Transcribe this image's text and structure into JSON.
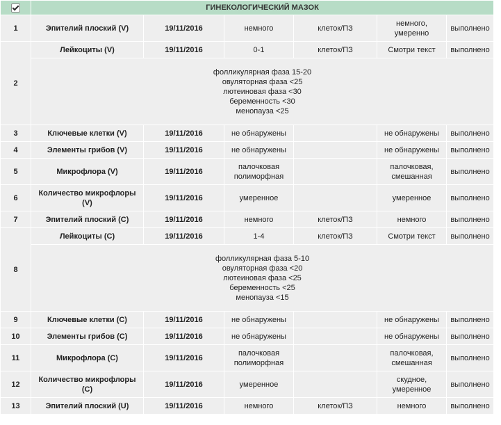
{
  "header": {
    "title": "ГИНЕКОЛОГИЧЕСКИЙ МАЗОК",
    "select_all_checked": true
  },
  "rows": [
    {
      "num": "1",
      "name": "Эпителий плоский (V)",
      "date": "19/11/2016",
      "result": "немного",
      "unit": "клеток/ПЗ",
      "ref": "немного, умеренно",
      "status": "выполнено"
    },
    {
      "num": "2",
      "name": "Лейкоциты (V)",
      "date": "19/11/2016",
      "result": "0-1",
      "unit": "клеток/ПЗ",
      "ref": "Смотри текст",
      "status": "выполнено",
      "note": [
        "фолликулярная фаза 15-20",
        "овуляторная фаза <25",
        "лютеиновая фаза <30",
        "беременность <30",
        "менопауза <25"
      ]
    },
    {
      "num": "3",
      "name": "Ключевые клетки (V)",
      "date": "19/11/2016",
      "result": "не обнаружены",
      "unit": "",
      "ref": "не обнаружены",
      "status": "выполнено"
    },
    {
      "num": "4",
      "name": "Элементы грибов (V)",
      "date": "19/11/2016",
      "result": "не обнаружены",
      "unit": "",
      "ref": "не обнаружены",
      "status": "выполнено"
    },
    {
      "num": "5",
      "name": "Микрофлора (V)",
      "date": "19/11/2016",
      "result": "палочковая полиморфная",
      "unit": "",
      "ref": "палочковая, смешанная",
      "status": "выполнено"
    },
    {
      "num": "6",
      "name": "Количество микрофлоры (V)",
      "date": "19/11/2016",
      "result": "умеренное",
      "unit": "",
      "ref": "умеренное",
      "status": "выполнено"
    },
    {
      "num": "7",
      "name": "Эпителий плоский (C)",
      "date": "19/11/2016",
      "result": "немного",
      "unit": "клеток/ПЗ",
      "ref": "немного",
      "status": "выполнено"
    },
    {
      "num": "8",
      "name": "Лейкоциты (C)",
      "date": "19/11/2016",
      "result": "1-4",
      "unit": "клеток/ПЗ",
      "ref": "Смотри текст",
      "status": "выполнено",
      "note": [
        "фолликулярная фаза 5-10",
        "овуляторная фаза <20",
        "лютеиновая фаза <25",
        "беременность <25",
        "менопауза <15"
      ]
    },
    {
      "num": "9",
      "name": "Ключевые клетки (C)",
      "date": "19/11/2016",
      "result": "не обнаружены",
      "unit": "",
      "ref": "не обнаружены",
      "status": "выполнено"
    },
    {
      "num": "10",
      "name": "Элементы грибов (C)",
      "date": "19/11/2016",
      "result": "не обнаружены",
      "unit": "",
      "ref": "не обнаружены",
      "status": "выполнено"
    },
    {
      "num": "11",
      "name": "Микрофлора (C)",
      "date": "19/11/2016",
      "result": "палочковая полиморфная",
      "unit": "",
      "ref": "палочковая, смешанная",
      "status": "выполнено"
    },
    {
      "num": "12",
      "name": "Количество микрофлоры (C)",
      "date": "19/11/2016",
      "result": "умеренное",
      "unit": "",
      "ref": "скудное, умеренное",
      "status": "выполнено"
    },
    {
      "num": "13",
      "name": "Эпителий плоский (U)",
      "date": "19/11/2016",
      "result": "немного",
      "unit": "клеток/ПЗ",
      "ref": "немного",
      "status": "выполнено"
    }
  ]
}
